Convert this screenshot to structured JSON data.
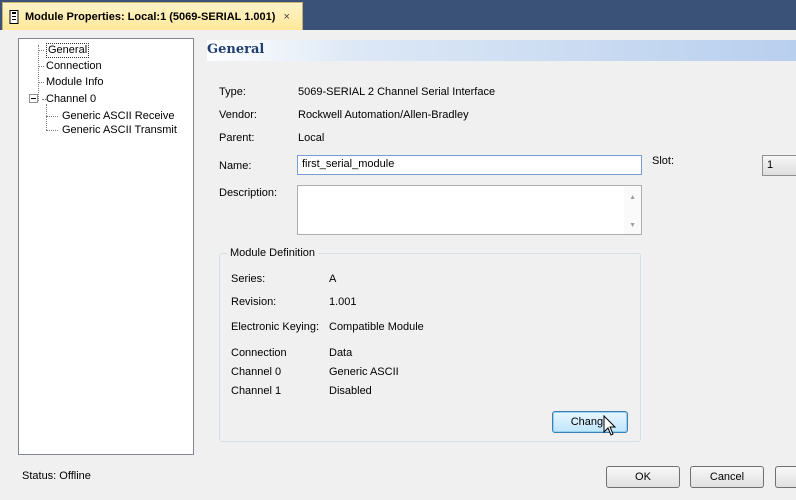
{
  "window": {
    "tab_title": "Module Properties: Local:1 (5069-SERIAL 1.001)",
    "close_glyph": "×",
    "title_bar_color": "#3a5278",
    "tab_color": "#ffe89a"
  },
  "tree": {
    "items": [
      {
        "label": "General",
        "selected": true
      },
      {
        "label": "Connection"
      },
      {
        "label": "Module Info"
      },
      {
        "label": "Channel 0",
        "expanded": true
      },
      {
        "label": "Generic ASCII Receive"
      },
      {
        "label": "Generic ASCII Transmit"
      }
    ]
  },
  "header": {
    "title": "General"
  },
  "general": {
    "type_label": "Type:",
    "type_value": "5069-SERIAL 2 Channel Serial Interface",
    "vendor_label": "Vendor:",
    "vendor_value": "Rockwell Automation/Allen-Bradley",
    "parent_label": "Parent:",
    "parent_value": "Local",
    "name_label": "Name:",
    "name_value": "first_serial_module",
    "description_label": "Description:",
    "description_value": "",
    "slot_label": "Slot:",
    "slot_value": "1"
  },
  "module_definition": {
    "title": "Module Definition",
    "series_label": "Series:",
    "series_value": "A",
    "revision_label": "Revision:",
    "revision_value": "1.001",
    "keying_label": "Electronic Keying:",
    "keying_value": "Compatible Module",
    "connection_label": "Connection",
    "connection_value": "Data",
    "channel0_label": "Channel 0",
    "channel0_value": "Generic ASCII",
    "channel1_label": "Channel 1",
    "channel1_value": "Disabled",
    "change_button": "Change"
  },
  "footer": {
    "status": "Status:  Offline",
    "ok_button": "OK",
    "cancel_button": "Cancel"
  },
  "icons": {
    "tab": "module-icon",
    "cursor": "mouse-pointer-icon",
    "scroll_up": "scroll-up-arrow-icon",
    "scroll_down": "scroll-down-arrow-icon"
  }
}
